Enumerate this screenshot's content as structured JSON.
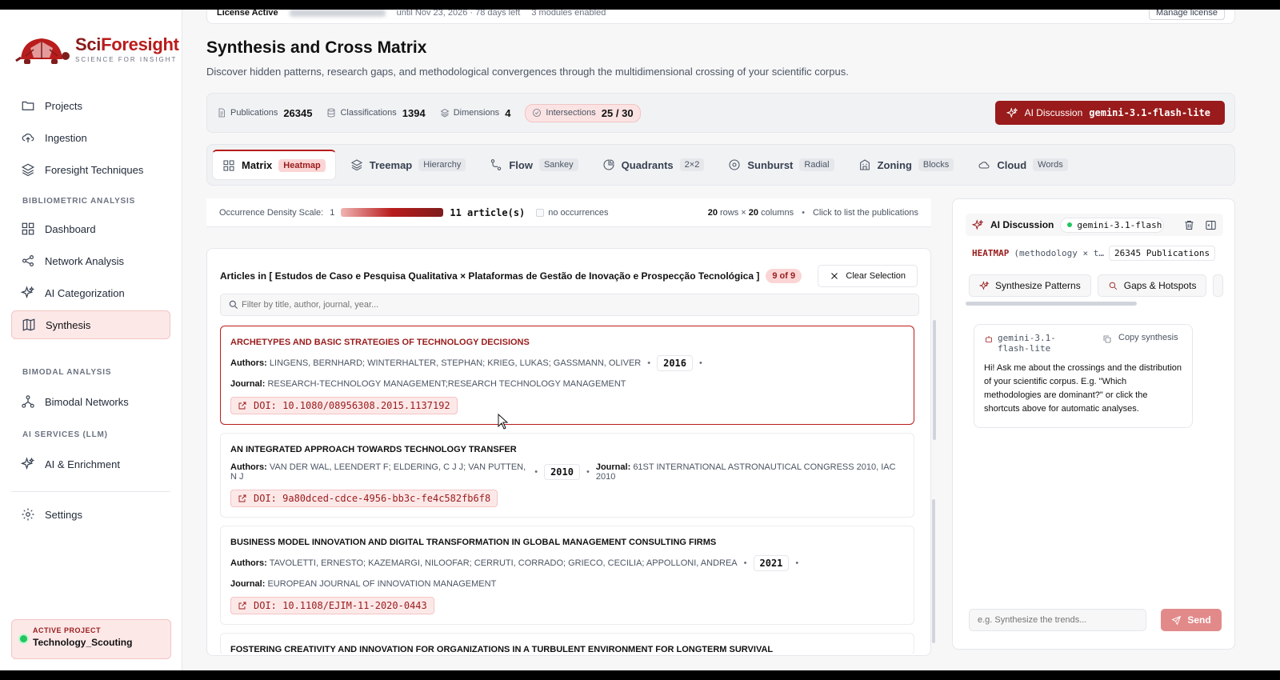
{
  "brand": {
    "name_a": "Sci",
    "name_b": "Foresight",
    "tagline": "SCIENCE FOR INSIGHT"
  },
  "sidebar": {
    "top_items": [
      {
        "label": "Projects",
        "icon": "folder-icon"
      },
      {
        "label": "Ingestion",
        "icon": "upload-cloud-icon"
      },
      {
        "label": "Foresight Techniques",
        "icon": "layers-icon"
      }
    ],
    "section_biblio": "BIBLIOMETRIC ANALYSIS",
    "biblio_items": [
      {
        "label": "Dashboard",
        "icon": "grid-icon"
      },
      {
        "label": "Network Analysis",
        "icon": "share-icon"
      },
      {
        "label": "AI Categorization",
        "icon": "sparkle-icon"
      },
      {
        "label": "Synthesis",
        "icon": "book-icon",
        "active": true
      }
    ],
    "section_bimodal": "BIMODAL ANALYSIS",
    "bimodal_items": [
      {
        "label": "Bimodal Networks",
        "icon": "network-icon"
      }
    ],
    "section_ai": "AI SERVICES (LLM)",
    "ai_items": [
      {
        "label": "AI & Enrichment",
        "icon": "sparkle-icon"
      }
    ],
    "settings_label": "Settings",
    "active_project_label": "ACTIVE PROJECT",
    "active_project_name": "Technology_Scouting"
  },
  "license": {
    "status": "License  Active",
    "until": "until Nov 23, 2026 · 78 days left",
    "modules": "3 modules enabled",
    "manage": "Manage license"
  },
  "page": {
    "title": "Synthesis and Cross Matrix",
    "subtitle": "Discover hidden patterns, research gaps, and methodological convergences through the multidimensional crossing of your scientific corpus."
  },
  "stats": {
    "publications_label": "Publications",
    "publications": "26345",
    "classifications_label": "Classifications",
    "classifications": "1394",
    "dimensions_label": "Dimensions",
    "dimensions": "4",
    "intersections_label": "Intersections",
    "intersections": "25 / 30",
    "ai_label": "AI Discussion",
    "ai_model": "gemini-3.1-flash-lite"
  },
  "tabs": [
    {
      "label": "Matrix",
      "badge": "Heatmap"
    },
    {
      "label": "Treemap",
      "badge": "Hierarchy"
    },
    {
      "label": "Flow",
      "badge": "Sankey"
    },
    {
      "label": "Quadrants",
      "badge": "2×2"
    },
    {
      "label": "Sunburst",
      "badge": "Radial"
    },
    {
      "label": "Zoning",
      "badge": "Blocks"
    },
    {
      "label": "Cloud",
      "badge": "Words"
    }
  ],
  "scale": {
    "label": "Occurrence Density Scale:",
    "min": "1",
    "max": "11 article(s)",
    "no_occ": "no occurrences",
    "rows": "20",
    "rows_label": "rows ×",
    "cols": "20",
    "cols_label": "columns",
    "hint": "Click to list the publications"
  },
  "articles": {
    "heading": "Articles in [ Estudos de Caso e Pesquisa Qualitativa × Plataformas de Gestão de Inovação e Prospecção Tecnológica ]",
    "count": "9 of 9",
    "clear": "Clear Selection",
    "filter_placeholder": "Filter by title, author, journal, year...",
    "authors_label": "Authors:",
    "journal_label": "Journal:",
    "items": [
      {
        "title": "ARCHETYPES AND BASIC STRATEGIES OF TECHNOLOGY DECISIONS",
        "authors": "LINGENS, BERNHARD; WINTERHALTER, STEPHAN; KRIEG, LUKAS; GASSMANN, OLIVER",
        "year": "2016",
        "journal": "RESEARCH-TECHNOLOGY MANAGEMENT;RESEARCH TECHNOLOGY MANAGEMENT",
        "doi": "DOI: 10.1080/08956308.2015.1137192"
      },
      {
        "title": "AN INTEGRATED APPROACH TOWARDS TECHNOLOGY TRANSFER",
        "authors": "VAN DER WAL, LEENDERT F; ELDERING, C J J; VAN PUTTEN, N J",
        "year": "2010",
        "journal": "61ST INTERNATIONAL ASTRONAUTICAL CONGRESS 2010, IAC 2010",
        "doi": "DOI: 9a80dced-cdce-4956-bb3c-fe4c582fb6f8"
      },
      {
        "title": "BUSINESS MODEL INNOVATION AND DIGITAL TRANSFORMATION IN GLOBAL MANAGEMENT CONSULTING FIRMS",
        "authors": "TAVOLETTI, ERNESTO; KAZEMARGI, NILOOFAR; CERRUTI, CORRADO; GRIECO, CECILIA; APPOLLONI, ANDREA",
        "year": "2021",
        "journal": "EUROPEAN JOURNAL OF INNOVATION MANAGEMENT",
        "doi": "DOI: 10.1108/EJIM-11-2020-0443"
      },
      {
        "title": "FOSTERING CREATIVITY AND INNOVATION FOR ORGANIZATIONS IN A TURBULENT ENVIRONMENT FOR LONGTERM SURVIVAL"
      }
    ]
  },
  "ai_panel": {
    "title": "AI Discussion",
    "model": "gemini-3.1-flash-…",
    "context_type": "HEATMAP",
    "context": "(methodology × t…",
    "publications": "26345 Publications",
    "shortcut_1": "Synthesize Patterns",
    "shortcut_2": "Gaps & Hotspots",
    "msg_model": "gemini-3.1-flash-lite",
    "copy": "Copy synthesis",
    "message": "Hi! Ask me about the crossings and the distribution of your scientific corpus. E.g. \"Which methodologies are dominant?\" or click the shortcuts above for automatic analyses.",
    "input_placeholder": "e.g. Synthesize the trends...",
    "send": "Send"
  }
}
